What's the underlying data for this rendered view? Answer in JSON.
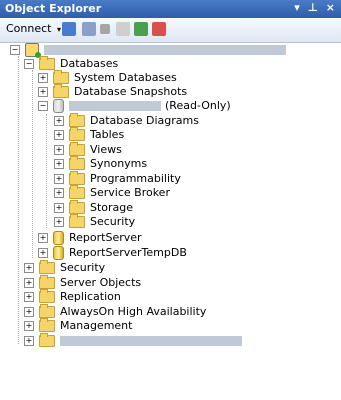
{
  "window": {
    "title": "Object Explorer",
    "icons": [
      "▾",
      "⊥",
      "×"
    ]
  },
  "toolbar": {
    "connect_label": "Connect",
    "connect_arrow": "▾"
  },
  "tree": {
    "root": {
      "name": ""
    },
    "databases": "Databases",
    "system_databases": "System Databases",
    "database_snapshots": "Database Snapshots",
    "db_readonly_suffix": "(Read-Only)",
    "db_children": [
      "Database Diagrams",
      "Tables",
      "Views",
      "Synonyms",
      "Programmability",
      "Service Broker",
      "Storage",
      "Security"
    ],
    "report_server": "ReportServer",
    "report_server_temp": "ReportServerTempDB",
    "top_level": [
      "Security",
      "Server Objects",
      "Replication",
      "AlwaysOn High Availability",
      "Management"
    ]
  },
  "colors": {
    "title_bar": "#3366b4",
    "folder": "#f5d46a"
  }
}
